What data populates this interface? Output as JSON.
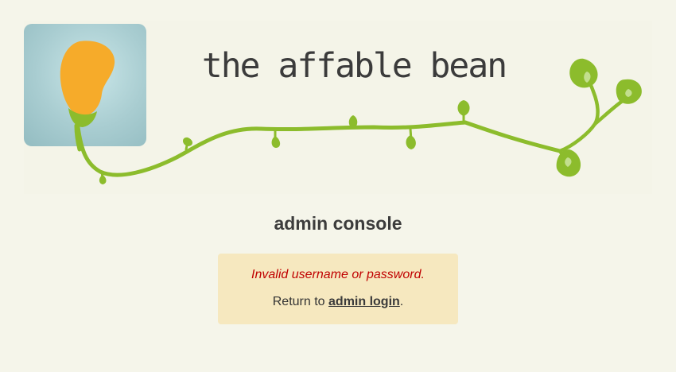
{
  "header": {
    "site_title": "the affable bean",
    "logo_icon": "bean-logo-icon",
    "decoration_icon": "vine-icon"
  },
  "main": {
    "heading": "admin console",
    "message": {
      "error": "Invalid username or password.",
      "return_prefix": "Return to ",
      "link_label": "admin login",
      "return_suffix": "."
    }
  },
  "colors": {
    "background": "#f5f5ea",
    "vine_green": "#8cbc2c",
    "bean_orange": "#f6ab2a",
    "logo_blue": "#a9cdd1",
    "error_red": "#c00000",
    "message_background": "#f6e8bf"
  }
}
